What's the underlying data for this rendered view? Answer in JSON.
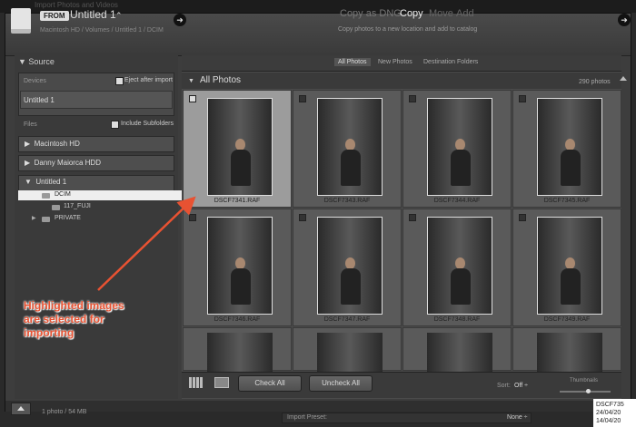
{
  "window": {
    "title": "Import Photos and Videos"
  },
  "header": {
    "from_label": "FROM",
    "source_title": "Untitled 1",
    "source_caret": "⌃",
    "source_path": "Macintosh HD / Volumes / Untitled 1 / DCIM",
    "arrow_glyph": "➜",
    "modes": [
      "Copy as DNG",
      "Copy",
      "Move",
      "Add"
    ],
    "mode_description": "Copy photos to a new location and add to catalog"
  },
  "source_panel": {
    "title": "Source",
    "devices_label": "Devices",
    "eject_label": "Eject after import",
    "device_item": "Untitled 1",
    "files_label": "Files",
    "subfolders_label": "Include Subfolders",
    "volumes": [
      "Macintosh HD",
      "Danny Maiorca HDD",
      "Untitled 1"
    ],
    "folders": [
      "DCIM",
      "117_FUJI",
      "PRIVATE"
    ]
  },
  "tabs": [
    "All Photos",
    "New Photos",
    "Destination Folders"
  ],
  "grid": {
    "title": "All Photos",
    "photo_count": "290 photos",
    "cells": [
      {
        "name": "DSCF7341.RAF",
        "selected": true
      },
      {
        "name": "DSCF7343.RAF",
        "selected": false
      },
      {
        "name": "DSCF7344.RAF",
        "selected": false
      },
      {
        "name": "DSCF7345.RAF",
        "selected": false
      },
      {
        "name": "DSCF7346.RAF",
        "selected": false
      },
      {
        "name": "DSCF7347.RAF",
        "selected": false
      },
      {
        "name": "DSCF7348.RAF",
        "selected": false
      },
      {
        "name": "DSCF7349.RAF",
        "selected": false
      }
    ]
  },
  "toolbar": {
    "check_all": "Check All",
    "uncheck_all": "Uncheck All",
    "sort_label": "Sort:",
    "sort_value": "Off ÷",
    "thumbnails_label": "Thumbnails"
  },
  "status": {
    "selection": "1 photo / 54 MB",
    "import_preset_label": "Import Preset:",
    "import_preset_value": "None ÷"
  },
  "overlay": {
    "date_line1": "DSCF735",
    "date_line2": "24/04/20",
    "date_line3": "14/04/20",
    "annotation_lines": [
      "Highlighted images",
      "are selected for",
      "importing"
    ],
    "annotation_color": "#e85232"
  }
}
